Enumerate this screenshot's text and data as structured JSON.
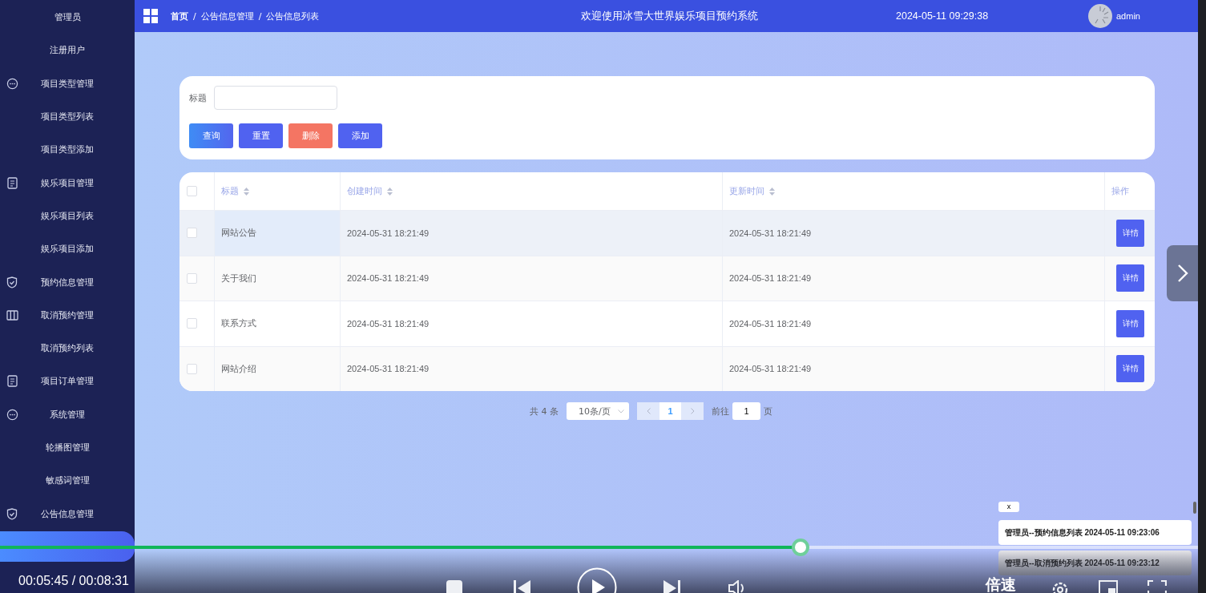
{
  "sidebar": {
    "items": [
      {
        "label": "管理员",
        "kind": "link",
        "selected": false
      },
      {
        "label": "注册用户",
        "kind": "link",
        "selected": false
      },
      {
        "label": "项目类型管理",
        "kind": "group",
        "selected": false
      },
      {
        "label": "项目类型列表",
        "kind": "link",
        "selected": false
      },
      {
        "label": "项目类型添加",
        "kind": "link",
        "selected": false
      },
      {
        "label": "娱乐项目管理",
        "kind": "group",
        "selected": false
      },
      {
        "label": "娱乐项目列表",
        "kind": "link",
        "selected": false
      },
      {
        "label": "娱乐项目添加",
        "kind": "link",
        "selected": false
      },
      {
        "label": "预约信息管理",
        "kind": "group",
        "selected": false
      },
      {
        "label": "取消预约管理",
        "kind": "group",
        "selected": false
      },
      {
        "label": "取消预约列表",
        "kind": "link",
        "selected": false
      },
      {
        "label": "项目订单管理",
        "kind": "group",
        "selected": false
      },
      {
        "label": "系统管理",
        "kind": "group",
        "selected": false
      },
      {
        "label": "轮播图管理",
        "kind": "link",
        "selected": false
      },
      {
        "label": "敏感词管理",
        "kind": "link",
        "selected": false
      },
      {
        "label": "公告信息管理",
        "kind": "group",
        "selected": false
      },
      {
        "kind": "link",
        "selected": true
      }
    ]
  },
  "header": {
    "breadcrumb": [
      "首页",
      "公告信息管理",
      "公告信息列表"
    ],
    "separator": "/",
    "title": "欢迎使用冰雪大世界娱乐项目预约系统",
    "datetime": "2024-05-11 09:29:38",
    "user": "admin"
  },
  "search": {
    "label": "标题",
    "buttons": [
      {
        "label": "查询",
        "kind": "primary"
      },
      {
        "label": "重置",
        "kind": "normal"
      },
      {
        "label": "删除",
        "kind": "danger"
      },
      {
        "label": "添加",
        "kind": "normal"
      }
    ]
  },
  "table": {
    "select_all_checked": false,
    "columns": [
      "标题",
      "创建时间",
      "更新时间",
      "操作"
    ],
    "rows": [
      {
        "checked": false,
        "hovered": true,
        "title": "网站公告",
        "created": "2024-05-31 18:21:49",
        "updated": "2024-05-31 18:21:49",
        "action": "详情"
      },
      {
        "checked": false,
        "hovered": false,
        "title": "关于我们",
        "created": "2024-05-31 18:21:49",
        "updated": "2024-05-31 18:21:49",
        "action": "详情"
      },
      {
        "checked": false,
        "hovered": false,
        "title": "联系方式",
        "created": "2024-05-31 18:21:49",
        "updated": "2024-05-31 18:21:49",
        "action": "详情"
      },
      {
        "checked": false,
        "hovered": false,
        "title": "网站介绍",
        "created": "2024-05-31 18:21:49",
        "updated": "2024-05-31 18:21:49",
        "action": "详情"
      }
    ]
  },
  "pagination": {
    "total": "共 4 条",
    "page_size": "10条/页",
    "pages": [
      {
        "label": "1",
        "selected": true
      }
    ],
    "goto_label": "前往",
    "goto_value": "1",
    "page_suffix": "页"
  },
  "notifications": {
    "close": "x",
    "items": [
      {
        "text": "管理员--预约信息列表 2024-05-11 09:23:06",
        "kind": "active"
      },
      {
        "text": "管理员--取消预约列表 2024-05-11 09:23:12",
        "kind": "inactive"
      }
    ]
  },
  "player": {
    "time": "00:05:45 / 00:08:31",
    "level": 0.668,
    "speed_label": "倍速"
  }
}
